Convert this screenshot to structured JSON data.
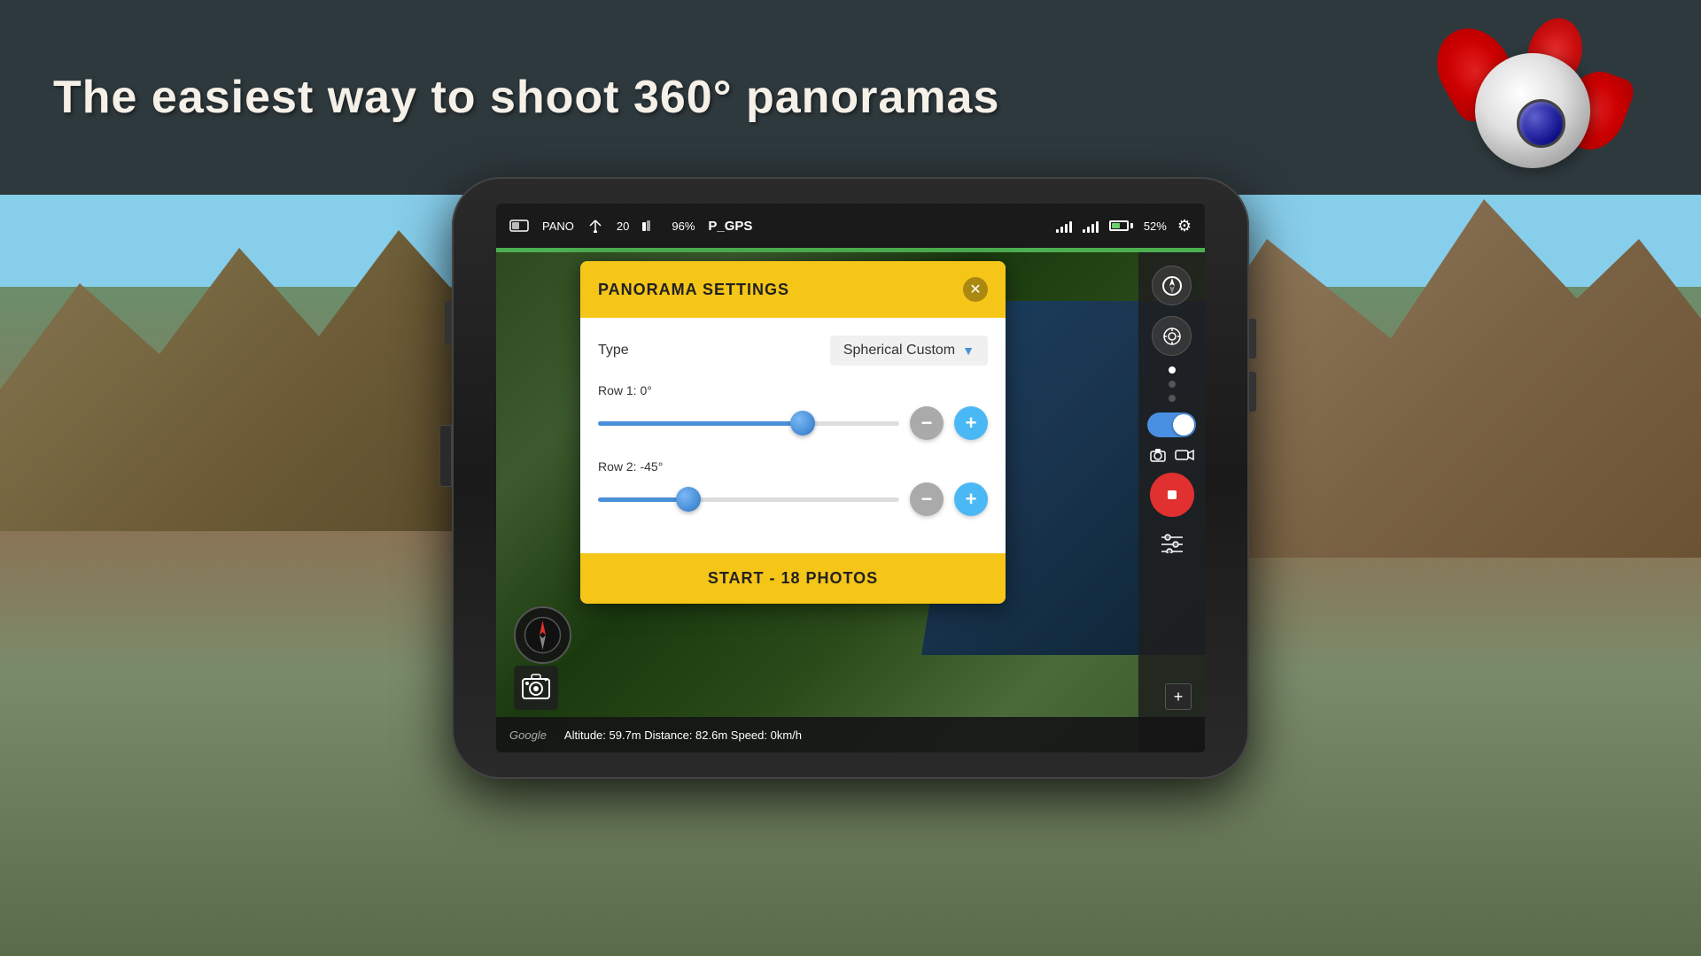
{
  "header": {
    "headline": "The easiest way to shoot 360° panoramas"
  },
  "statusBar": {
    "mode": "PANO",
    "count": "20",
    "signal1": "96%",
    "gps": "P_GPS",
    "signal2": "",
    "signal3": "",
    "battery": "52%",
    "settingsIcon": "⚙"
  },
  "dialog": {
    "title": "PANORAMA SETTINGS",
    "closeLabel": "✕",
    "typeLabel": "Type",
    "typeValue": "Spherical Custom",
    "row1Label": "Row 1: 0°",
    "row2Label": "Row 2: -45°",
    "row1SliderPct": 68,
    "row2SliderPct": 30,
    "startButton": "START - 18 PHOTOS",
    "minusLabel": "−",
    "plusLabel": "+"
  },
  "map": {
    "altitudeText": "Altitude: 59.7m  Distance: 82.6m  Speed: 0km/h",
    "googleLabel": "Google"
  },
  "sidebar": {
    "compassIcon": "◎",
    "targetIcon": "⊕"
  }
}
